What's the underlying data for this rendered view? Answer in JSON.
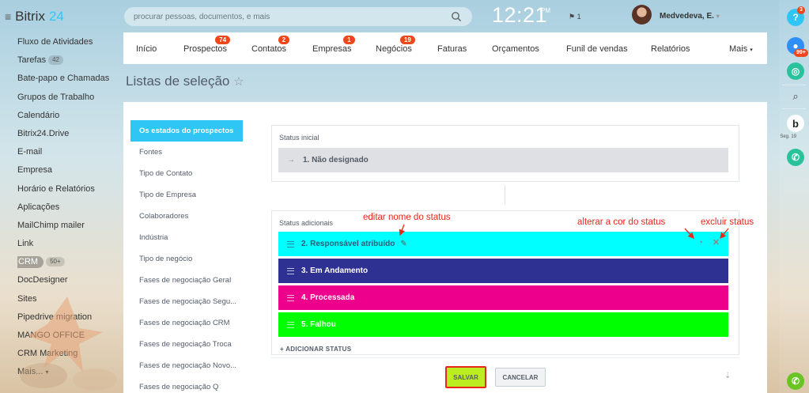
{
  "app": {
    "logo_text": "Bitrix",
    "logo_num": "24"
  },
  "sidebar": {
    "items": [
      {
        "label": "Fluxo de Atividades"
      },
      {
        "label": "Tarefas",
        "count": "42"
      },
      {
        "label": "Bate-papo e Chamadas"
      },
      {
        "label": "Grupos de Trabalho"
      },
      {
        "label": "Calendário"
      },
      {
        "label": "Bitrix24.Drive"
      },
      {
        "label": "E-mail"
      },
      {
        "label": "Empresa"
      },
      {
        "label": "Horário e Relatórios"
      },
      {
        "label": "Aplicações"
      },
      {
        "label": "MailChimp mailer"
      },
      {
        "label": "Link"
      },
      {
        "label": "CRM",
        "count": "50+"
      },
      {
        "label": "DocDesigner"
      },
      {
        "label": "Sites"
      },
      {
        "label": "Pipedrive migration"
      },
      {
        "label": "MANGO OFFICE"
      },
      {
        "label": "CRM Marketing"
      },
      {
        "label": "Mais..."
      }
    ]
  },
  "header": {
    "search_placeholder": "procurar pessoas, documentos, e mais",
    "time": "12:21",
    "ampm": "PM",
    "flag_count": "1",
    "username": "Medvedeva, E."
  },
  "topnav": [
    {
      "label": "Início"
    },
    {
      "label": "Prospectos",
      "badge": "74"
    },
    {
      "label": "Contatos",
      "badge": "2"
    },
    {
      "label": "Empresas",
      "badge": "1"
    },
    {
      "label": "Negócios",
      "badge": "19"
    },
    {
      "label": "Faturas"
    },
    {
      "label": "Orçamentos"
    },
    {
      "label": "Funil de vendas"
    },
    {
      "label": "Relatórios"
    },
    {
      "label": "Mais"
    }
  ],
  "page": {
    "title": "Listas de seleção"
  },
  "left_tabs": [
    "Os estados do prospectos",
    "Fontes",
    "Tipo de Contato",
    "Tipo de Empresa",
    "Colaboradores",
    "Indústria",
    "Tipo de negócio",
    "Fases de negociação Geral",
    "Fases de negociação Segu...",
    "Fases de negociação CRM",
    "Fases de negociação Troca",
    "Fases de negociação Novo...",
    "Fases de negociação Q"
  ],
  "initial": {
    "title": "Status inicial",
    "status": "1. Não designado",
    "color": "#dfe0e3"
  },
  "additional": {
    "title": "Status adicionais",
    "add_label": "+ ADICIONAR STATUS",
    "statuses": [
      {
        "label": "2. Responsável atribuído",
        "color": "#00ffff"
      },
      {
        "label": "3. Em Andamento",
        "color": "#2e3192"
      },
      {
        "label": "4. Processada",
        "color": "#ec008c"
      },
      {
        "label": "5. Falhou",
        "color": "#00ff00"
      }
    ]
  },
  "annotations": {
    "edit": "editar nome do status",
    "color": "alterar a cor do status",
    "delete": "excluir status"
  },
  "buttons": {
    "save": "SALVAR",
    "cancel": "CANCELAR"
  },
  "right_rail": {
    "help_badge": "3",
    "notif_badge": "99+",
    "b_caption": "Seg. 19"
  },
  "colors": {
    "accent": "#2fc6f6",
    "save": "#bbed21",
    "annotation": "#e8261a",
    "badge": "#f0461b"
  }
}
